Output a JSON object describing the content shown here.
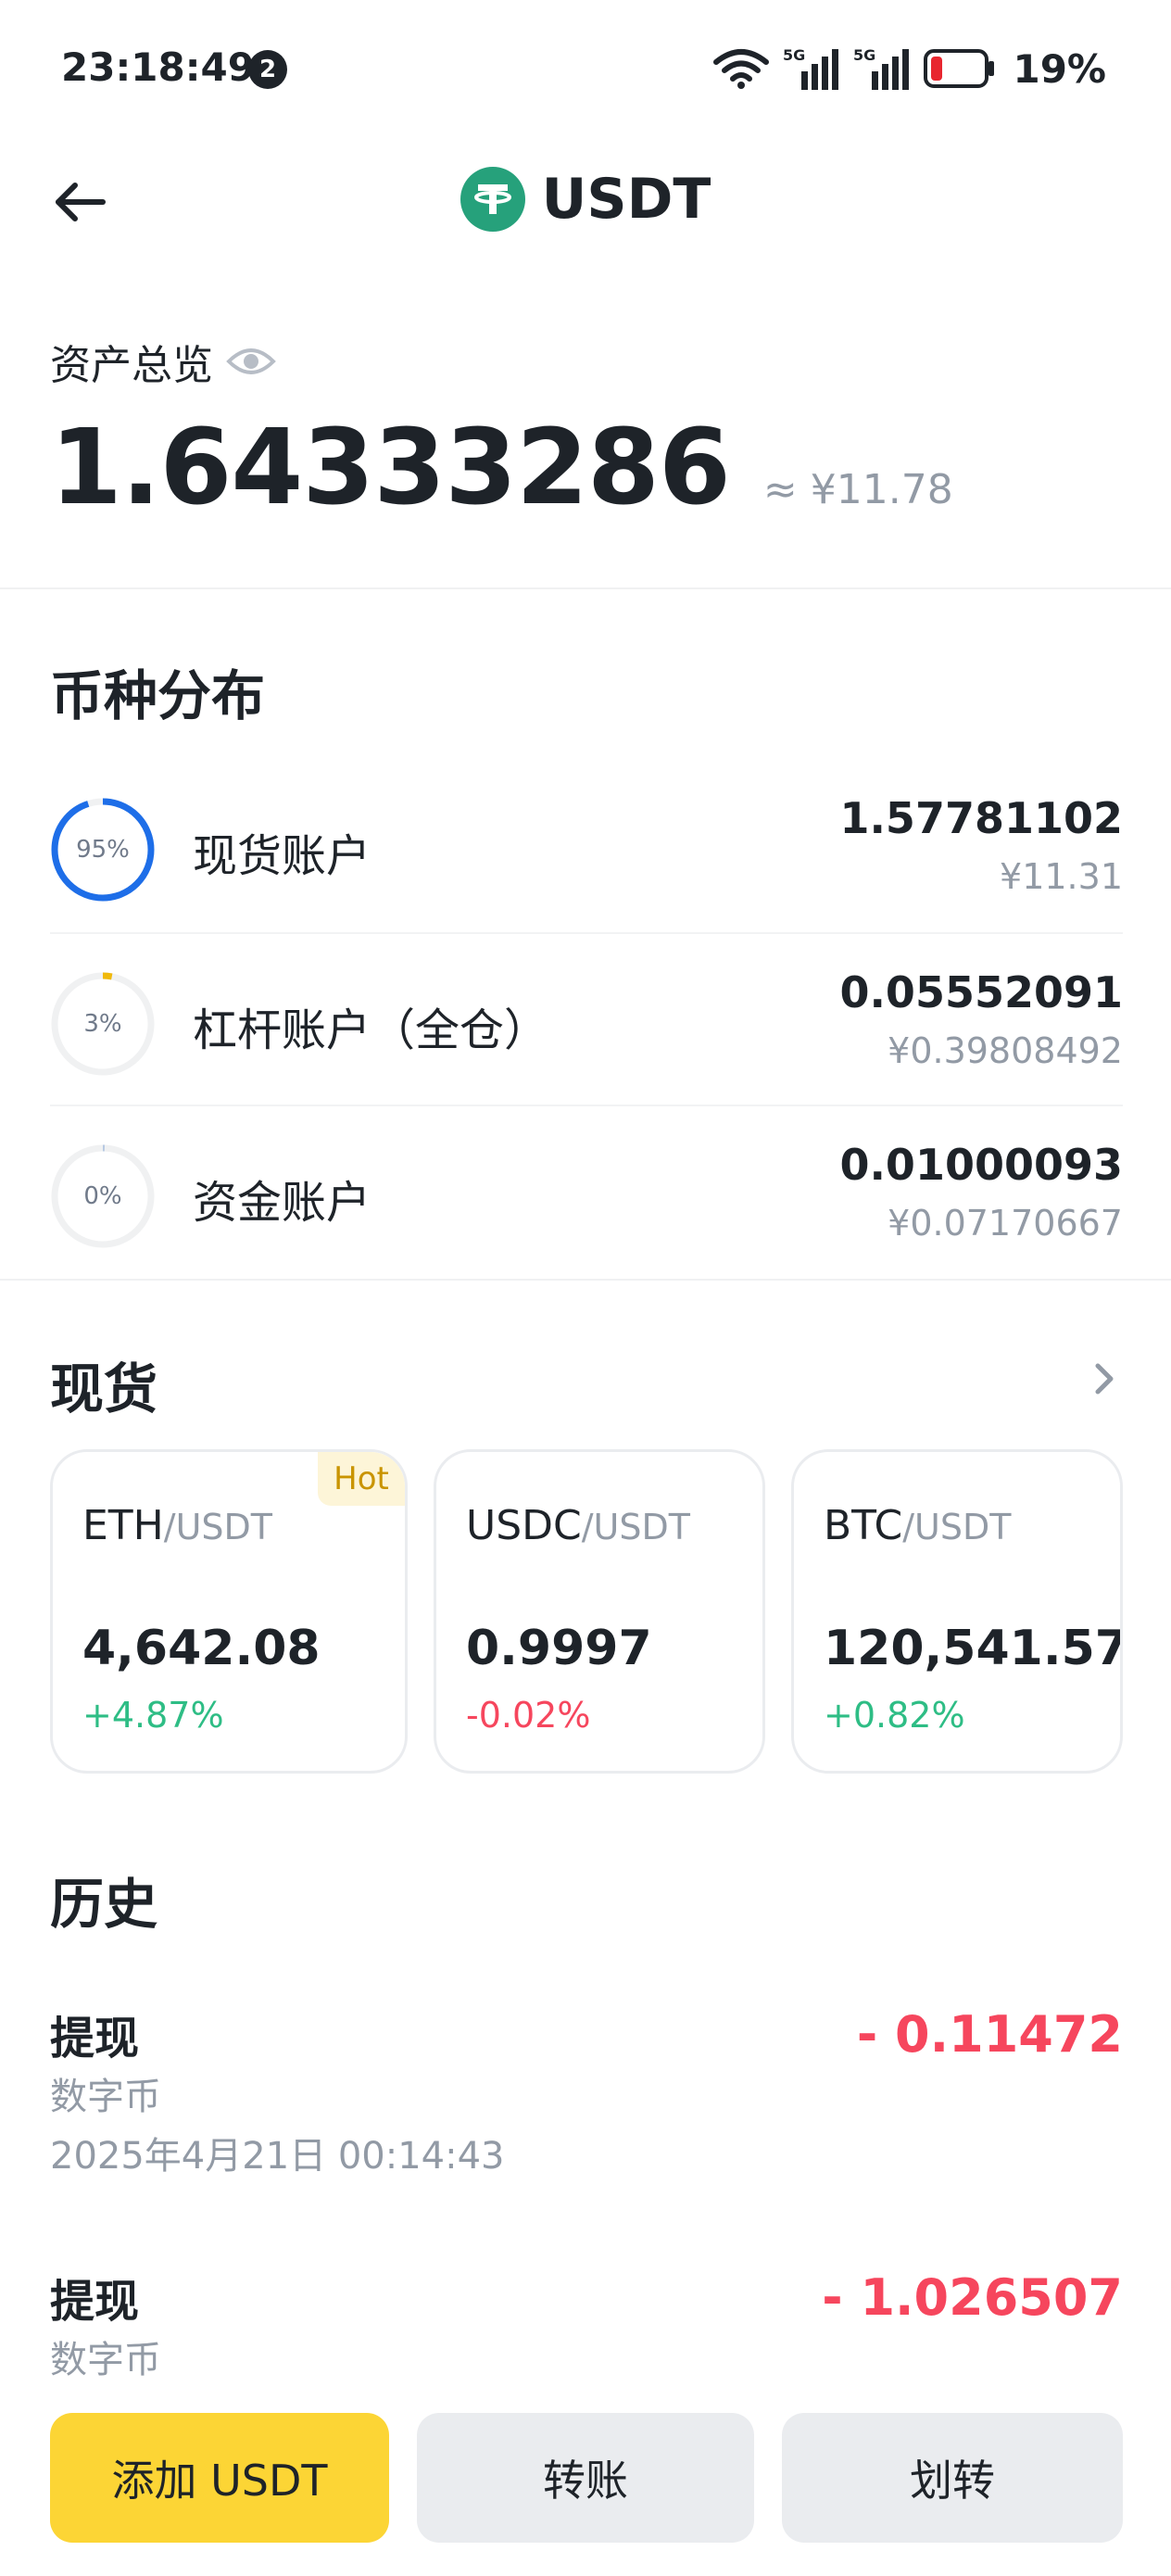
{
  "status_bar": {
    "time": "23:18:49",
    "notification_count": "2",
    "battery": "19%",
    "network_1": "5G",
    "network_2": "5G"
  },
  "header": {
    "title": "USDT",
    "back_icon": "arrow-left-icon",
    "logo_icon": "tether-logo"
  },
  "overview": {
    "label": "资产总览",
    "total": "1.64333286",
    "fiat": "≈ ¥11.78"
  },
  "distribution": {
    "title": "币种分布",
    "items": [
      {
        "pct_label": "95%",
        "pct": 0.95,
        "name": "现货账户",
        "amount": "1.57781102",
        "fiat": "¥11.31",
        "color": "#1e6ee8"
      },
      {
        "pct_label": "3%",
        "pct": 0.03,
        "name": "杠杆账户（全仓）",
        "amount": "0.05552091",
        "fiat": "¥0.39808492",
        "color": "#f0b90b"
      },
      {
        "pct_label": "0%",
        "pct": 0.005,
        "name": "资金账户",
        "amount": "0.01000093",
        "fiat": "¥0.07170667",
        "color": "#b7c9e2"
      }
    ]
  },
  "spot": {
    "title": "现货",
    "pairs": [
      {
        "base": "ETH",
        "quote": "/USDT",
        "price": "4,642.08",
        "change": "+4.87%",
        "direction": "up",
        "badge": "Hot"
      },
      {
        "base": "USDC",
        "quote": "/USDT",
        "price": "0.9997",
        "change": "-0.02%",
        "direction": "down",
        "badge": ""
      },
      {
        "base": "BTC",
        "quote": "/USDT",
        "price": "120,541.57",
        "change": "+0.82%",
        "direction": "up",
        "badge": ""
      }
    ]
  },
  "history": {
    "title": "历史",
    "items": [
      {
        "type": "提现",
        "sub": "数字币",
        "time": "2025年4月21日 00:14:43",
        "amount": "- 0.11472"
      },
      {
        "type": "提现",
        "sub": "数字币",
        "time": "",
        "amount": "- 1.026507"
      }
    ]
  },
  "actions": {
    "add": "添加 USDT",
    "transfer": "转账",
    "move": "划转"
  },
  "colors": {
    "primary_yellow": "#fcd535",
    "up_green": "#2ebd85",
    "down_red": "#f6465d",
    "tether_green": "#26a17b"
  }
}
